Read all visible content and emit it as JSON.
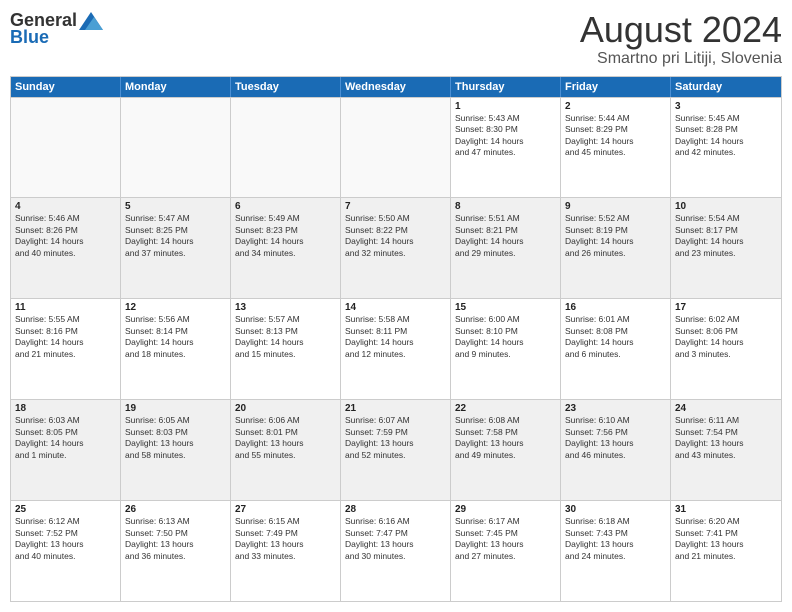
{
  "header": {
    "logo_general": "General",
    "logo_blue": "Blue",
    "month_title": "August 2024",
    "location": "Smartno pri Litiji, Slovenia"
  },
  "days_of_week": [
    "Sunday",
    "Monday",
    "Tuesday",
    "Wednesday",
    "Thursday",
    "Friday",
    "Saturday"
  ],
  "rows": [
    [
      {
        "day": "",
        "empty": true,
        "text": ""
      },
      {
        "day": "",
        "empty": true,
        "text": ""
      },
      {
        "day": "",
        "empty": true,
        "text": ""
      },
      {
        "day": "",
        "empty": true,
        "text": ""
      },
      {
        "day": "1",
        "text": "Sunrise: 5:43 AM\nSunset: 8:30 PM\nDaylight: 14 hours\nand 47 minutes."
      },
      {
        "day": "2",
        "text": "Sunrise: 5:44 AM\nSunset: 8:29 PM\nDaylight: 14 hours\nand 45 minutes."
      },
      {
        "day": "3",
        "text": "Sunrise: 5:45 AM\nSunset: 8:28 PM\nDaylight: 14 hours\nand 42 minutes."
      }
    ],
    [
      {
        "day": "4",
        "text": "Sunrise: 5:46 AM\nSunset: 8:26 PM\nDaylight: 14 hours\nand 40 minutes."
      },
      {
        "day": "5",
        "text": "Sunrise: 5:47 AM\nSunset: 8:25 PM\nDaylight: 14 hours\nand 37 minutes."
      },
      {
        "day": "6",
        "text": "Sunrise: 5:49 AM\nSunset: 8:23 PM\nDaylight: 14 hours\nand 34 minutes."
      },
      {
        "day": "7",
        "text": "Sunrise: 5:50 AM\nSunset: 8:22 PM\nDaylight: 14 hours\nand 32 minutes."
      },
      {
        "day": "8",
        "text": "Sunrise: 5:51 AM\nSunset: 8:21 PM\nDaylight: 14 hours\nand 29 minutes."
      },
      {
        "day": "9",
        "text": "Sunrise: 5:52 AM\nSunset: 8:19 PM\nDaylight: 14 hours\nand 26 minutes."
      },
      {
        "day": "10",
        "text": "Sunrise: 5:54 AM\nSunset: 8:17 PM\nDaylight: 14 hours\nand 23 minutes."
      }
    ],
    [
      {
        "day": "11",
        "text": "Sunrise: 5:55 AM\nSunset: 8:16 PM\nDaylight: 14 hours\nand 21 minutes."
      },
      {
        "day": "12",
        "text": "Sunrise: 5:56 AM\nSunset: 8:14 PM\nDaylight: 14 hours\nand 18 minutes."
      },
      {
        "day": "13",
        "text": "Sunrise: 5:57 AM\nSunset: 8:13 PM\nDaylight: 14 hours\nand 15 minutes."
      },
      {
        "day": "14",
        "text": "Sunrise: 5:58 AM\nSunset: 8:11 PM\nDaylight: 14 hours\nand 12 minutes."
      },
      {
        "day": "15",
        "text": "Sunrise: 6:00 AM\nSunset: 8:10 PM\nDaylight: 14 hours\nand 9 minutes."
      },
      {
        "day": "16",
        "text": "Sunrise: 6:01 AM\nSunset: 8:08 PM\nDaylight: 14 hours\nand 6 minutes."
      },
      {
        "day": "17",
        "text": "Sunrise: 6:02 AM\nSunset: 8:06 PM\nDaylight: 14 hours\nand 3 minutes."
      }
    ],
    [
      {
        "day": "18",
        "text": "Sunrise: 6:03 AM\nSunset: 8:05 PM\nDaylight: 14 hours\nand 1 minute."
      },
      {
        "day": "19",
        "text": "Sunrise: 6:05 AM\nSunset: 8:03 PM\nDaylight: 13 hours\nand 58 minutes."
      },
      {
        "day": "20",
        "text": "Sunrise: 6:06 AM\nSunset: 8:01 PM\nDaylight: 13 hours\nand 55 minutes."
      },
      {
        "day": "21",
        "text": "Sunrise: 6:07 AM\nSunset: 7:59 PM\nDaylight: 13 hours\nand 52 minutes."
      },
      {
        "day": "22",
        "text": "Sunrise: 6:08 AM\nSunset: 7:58 PM\nDaylight: 13 hours\nand 49 minutes."
      },
      {
        "day": "23",
        "text": "Sunrise: 6:10 AM\nSunset: 7:56 PM\nDaylight: 13 hours\nand 46 minutes."
      },
      {
        "day": "24",
        "text": "Sunrise: 6:11 AM\nSunset: 7:54 PM\nDaylight: 13 hours\nand 43 minutes."
      }
    ],
    [
      {
        "day": "25",
        "text": "Sunrise: 6:12 AM\nSunset: 7:52 PM\nDaylight: 13 hours\nand 40 minutes."
      },
      {
        "day": "26",
        "text": "Sunrise: 6:13 AM\nSunset: 7:50 PM\nDaylight: 13 hours\nand 36 minutes."
      },
      {
        "day": "27",
        "text": "Sunrise: 6:15 AM\nSunset: 7:49 PM\nDaylight: 13 hours\nand 33 minutes."
      },
      {
        "day": "28",
        "text": "Sunrise: 6:16 AM\nSunset: 7:47 PM\nDaylight: 13 hours\nand 30 minutes."
      },
      {
        "day": "29",
        "text": "Sunrise: 6:17 AM\nSunset: 7:45 PM\nDaylight: 13 hours\nand 27 minutes."
      },
      {
        "day": "30",
        "text": "Sunrise: 6:18 AM\nSunset: 7:43 PM\nDaylight: 13 hours\nand 24 minutes."
      },
      {
        "day": "31",
        "text": "Sunrise: 6:20 AM\nSunset: 7:41 PM\nDaylight: 13 hours\nand 21 minutes."
      }
    ]
  ]
}
